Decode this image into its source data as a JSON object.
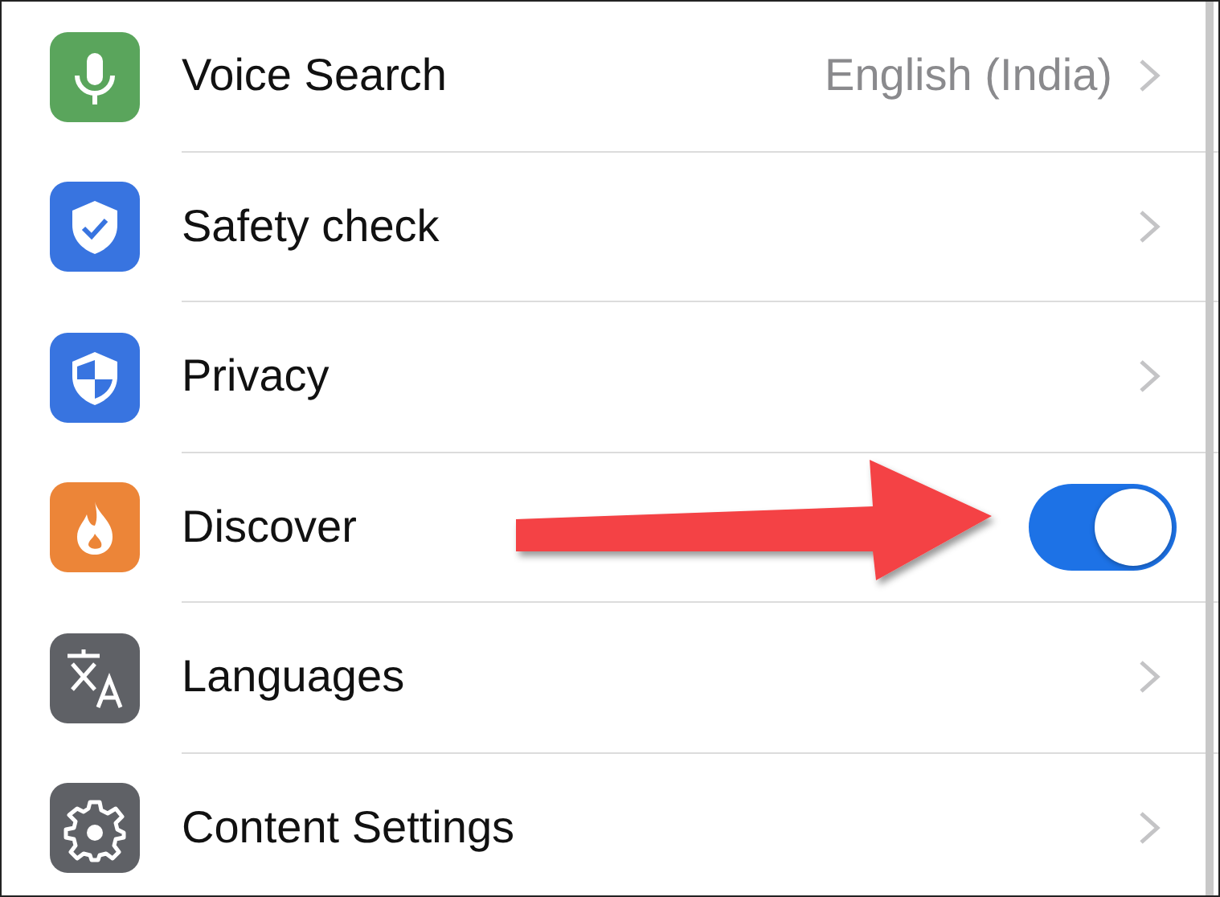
{
  "settings": [
    {
      "label": "Voice Search",
      "kind": "chevron",
      "value": "English (India)"
    },
    {
      "label": "Safety check",
      "kind": "chevron"
    },
    {
      "label": "Privacy",
      "kind": "chevron"
    },
    {
      "label": "Discover",
      "kind": "toggle",
      "on": true
    },
    {
      "label": "Languages",
      "kind": "chevron"
    },
    {
      "label": "Content Settings",
      "kind": "chevron"
    }
  ]
}
